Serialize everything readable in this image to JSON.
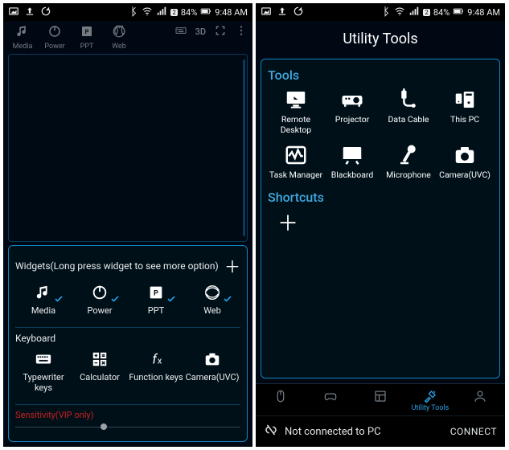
{
  "statusbar": {
    "battery_pct": "84%",
    "time": "9:48 AM"
  },
  "left": {
    "topnav": {
      "media": "Media",
      "power": "Power",
      "ppt": "PPT",
      "web": "Web",
      "mode3d": "3D"
    },
    "widgets": {
      "heading": "Widgets(Long press widget to see more option)",
      "items": {
        "media": "Media",
        "power": "Power",
        "ppt": "PPT",
        "web": "Web"
      }
    },
    "keyboard": {
      "heading": "Keyboard",
      "items": {
        "typewriter": "Typewriter keys",
        "calculator": "Calculator",
        "function": "Function keys",
        "camera": "Camera(UVC)"
      }
    },
    "sensitivity_label": "Sensitivity(VIP only)"
  },
  "right": {
    "title": "Utility Tools",
    "tools_heading": "Tools",
    "tools": {
      "remote_desktop": "Remote Desktop",
      "projector": "Projector",
      "data_cable": "Data Cable",
      "this_pc": "This PC",
      "task_manager": "Task Manager",
      "blackboard": "Blackboard",
      "microphone": "Microphone",
      "camera_uvc": "Camera(UVC)"
    },
    "shortcuts_heading": "Shortcuts",
    "bottomnav": {
      "utility_tools": "Utility Tools"
    },
    "connect": {
      "status": "Not connected to PC",
      "button": "CONNECT"
    }
  }
}
